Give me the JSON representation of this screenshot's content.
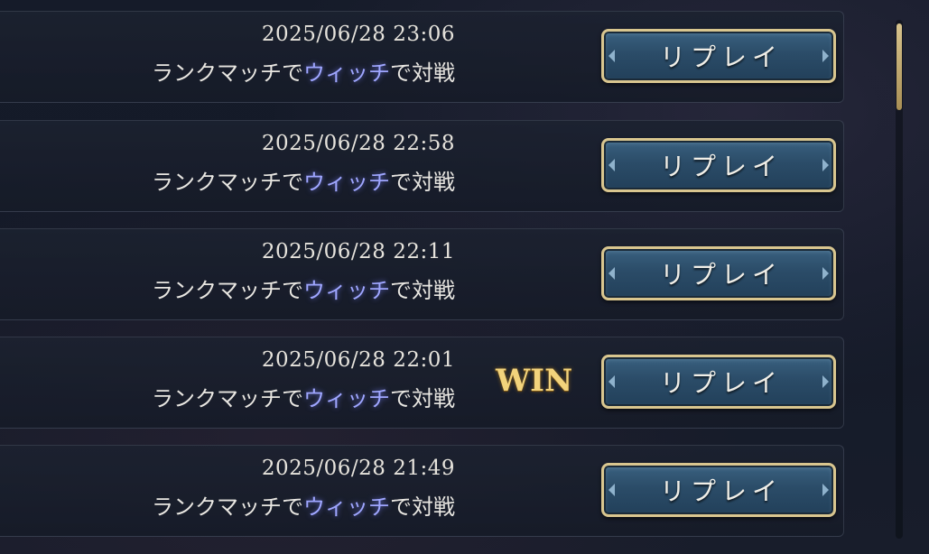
{
  "matches": [
    {
      "date": "2025/06/28 23:06",
      "prefix": "ランクマッチで",
      "class_name": "ウィッチ",
      "suffix": "で対戦",
      "result": "",
      "replay_label": "リプレイ"
    },
    {
      "date": "2025/06/28 22:58",
      "prefix": "ランクマッチで",
      "class_name": "ウィッチ",
      "suffix": "で対戦",
      "result": "",
      "replay_label": "リプレイ"
    },
    {
      "date": "2025/06/28 22:11",
      "prefix": "ランクマッチで",
      "class_name": "ウィッチ",
      "suffix": "で対戦",
      "result": "",
      "replay_label": "リプレイ"
    },
    {
      "date": "2025/06/28 22:01",
      "prefix": "ランクマッチで",
      "class_name": "ウィッチ",
      "suffix": "で対戦",
      "result": "WIN",
      "replay_label": "リプレイ"
    },
    {
      "date": "2025/06/28 21:49",
      "prefix": "ランクマッチで",
      "class_name": "ウィッチ",
      "suffix": "で対戦",
      "result": "",
      "replay_label": "リプレイ"
    }
  ],
  "scrollbar": {
    "position_fraction": 0.0
  },
  "colors": {
    "class_highlight": "#9fa6ff",
    "win_gold": "#f2d37c",
    "button_border_gold": "#d9c68f",
    "button_fill_blue": "#2b4c68"
  }
}
